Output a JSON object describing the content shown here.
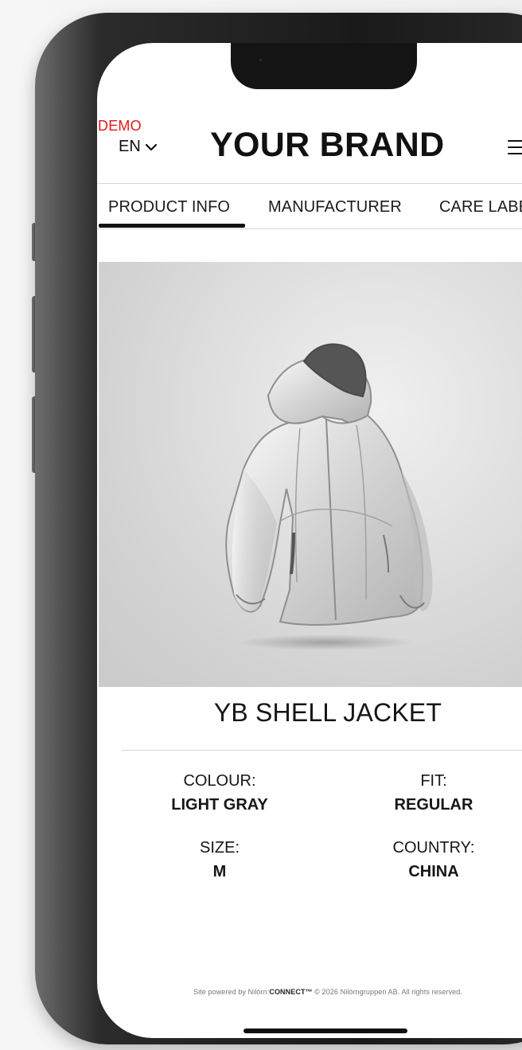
{
  "header": {
    "demo_label": "DEMO",
    "language": "EN",
    "brand": "YOUR BRAND",
    "menu_icon": "hamburger-menu-icon",
    "language_icon": "chevron-down-icon"
  },
  "tabs": [
    {
      "label": "PRODUCT INFO",
      "active": true
    },
    {
      "label": "MANUFACTURER",
      "active": false
    },
    {
      "label": "CARE LABEL",
      "active": false
    }
  ],
  "product": {
    "title": "YB SHELL JACKET",
    "image": {
      "name": "jacket-image"
    },
    "specs": [
      {
        "label": "COLOUR:",
        "value": "LIGHT GRAY"
      },
      {
        "label": "FIT:",
        "value": "REGULAR"
      },
      {
        "label": "SIZE:",
        "value": "M"
      },
      {
        "label": "COUNTRY:",
        "value": "CHINA"
      }
    ]
  },
  "footer": {
    "prefix": "Site powered by Nilörn:",
    "product": "CONNECT™",
    "suffix": " © 2026 Nilörngruppen AB. All rights reserved."
  },
  "colors": {
    "demo": "#e01919",
    "text": "#111111",
    "divider": "#d7d7d7",
    "background": "#ffffff"
  }
}
